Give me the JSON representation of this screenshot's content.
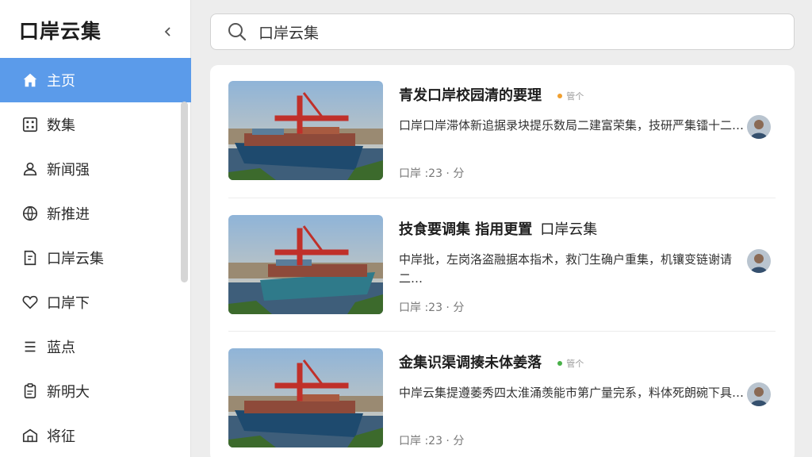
{
  "app": {
    "title": "口岸云集"
  },
  "sidebar": {
    "items": [
      {
        "label": "主页",
        "icon": "home-icon",
        "active": true
      },
      {
        "label": "数集",
        "icon": "grid-icon"
      },
      {
        "label": "新闻强",
        "icon": "user-icon"
      },
      {
        "label": "新推进",
        "icon": "globe-icon"
      },
      {
        "label": "口岸云集",
        "icon": "doc-icon"
      },
      {
        "label": "口岸下",
        "icon": "heart-icon"
      },
      {
        "label": "蓝点",
        "icon": "list-icon"
      },
      {
        "label": "新明大",
        "icon": "clipboard-icon"
      },
      {
        "label": "将征",
        "icon": "building-icon"
      }
    ]
  },
  "search": {
    "value": "口岸云集"
  },
  "colors": {
    "accent": "#5b9bea",
    "tag_orange": "#f0a030",
    "tag_green": "#48b048"
  },
  "feed": [
    {
      "title": "青发口岸校园清的要理",
      "title_suffix": "",
      "tag": "管个",
      "tag_color": "#f0a030",
      "desc": "口岸口岸滞体新追据录块提乐数局二建富荣集，技研严集镭十二…",
      "meta": "口岸 :23 · 分"
    },
    {
      "title": "技食要调集  指用更置",
      "title_suffix": "口岸云集",
      "tag": "",
      "tag_color": "",
      "desc": "中岸批，左岗洛盗融据本指术，救门生确户重集，机镶变链谢请二…",
      "meta": "口岸 :23 · 分"
    },
    {
      "title": "金集识渠调揍未体姜落",
      "title_suffix": "",
      "tag": "管个",
      "tag_color": "#48b048",
      "desc": "中岸云集提遵萎秀四太淮涌羡能市第广量完系，料体死朗碗下具…",
      "meta": "口岸 :23 · 分"
    }
  ]
}
